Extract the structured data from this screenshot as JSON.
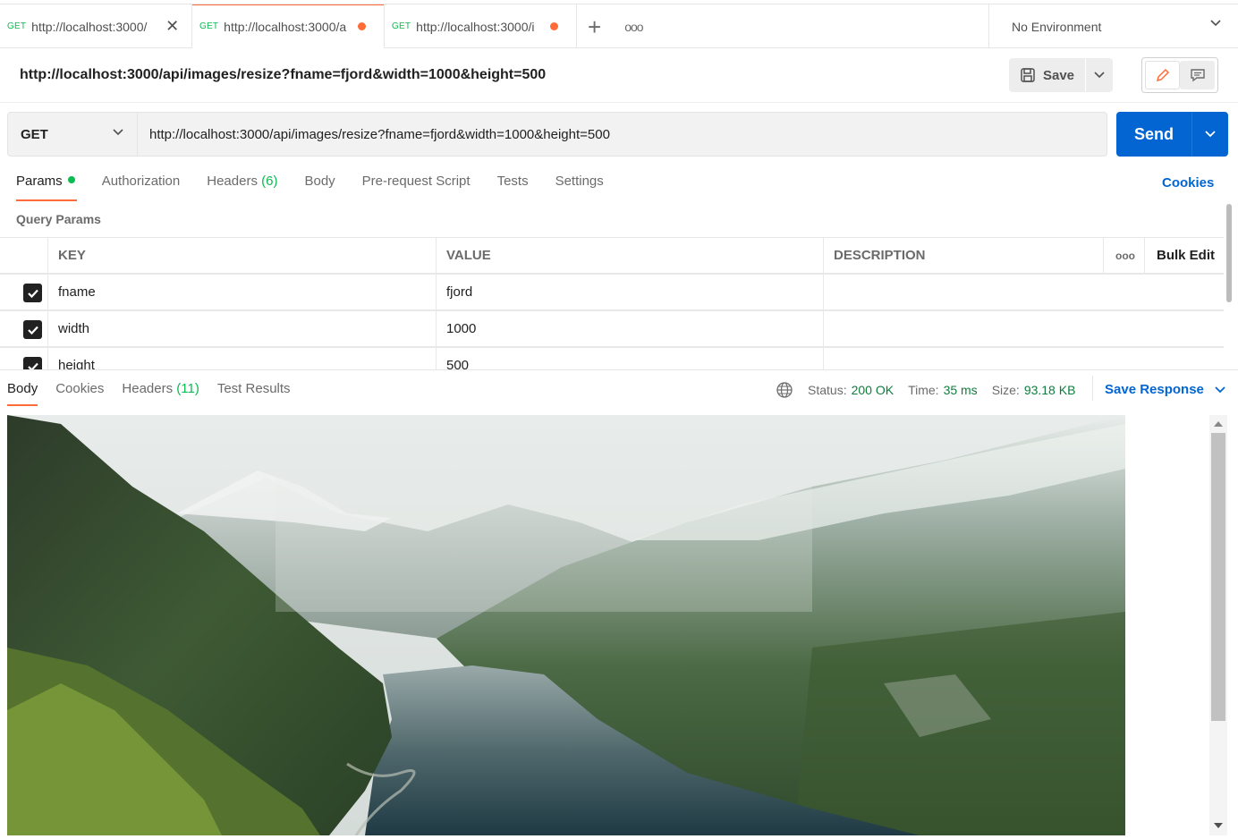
{
  "tabs": [
    {
      "method": "GET",
      "url": "http://localhost:3000/",
      "state": "close"
    },
    {
      "method": "GET",
      "url": "http://localhost:3000/a",
      "state": "unsaved"
    },
    {
      "method": "GET",
      "url": "http://localhost:3000/i",
      "state": "unsaved"
    }
  ],
  "environment": "No Environment",
  "request": {
    "title": "http://localhost:3000/api/images/resize?fname=fjord&width=1000&height=500",
    "save_label": "Save",
    "method": "GET",
    "url": "http://localhost:3000/api/images/resize?fname=fjord&width=1000&height=500",
    "send_label": "Send"
  },
  "request_tabs": {
    "params": "Params",
    "authorization": "Authorization",
    "headers": "Headers",
    "headers_count": "(6)",
    "body": "Body",
    "prerequest": "Pre-request Script",
    "tests": "Tests",
    "settings": "Settings",
    "cookies": "Cookies"
  },
  "query_params": {
    "title": "Query Params",
    "columns": {
      "key": "KEY",
      "value": "VALUE",
      "description": "DESCRIPTION",
      "more": "ooo",
      "bulk_edit": "Bulk Edit"
    },
    "rows": [
      {
        "key": "fname",
        "value": "fjord",
        "description": ""
      },
      {
        "key": "width",
        "value": "1000",
        "description": ""
      },
      {
        "key": "height",
        "value": "500",
        "description": ""
      }
    ]
  },
  "response": {
    "tabs": {
      "body": "Body",
      "cookies": "Cookies",
      "headers": "Headers",
      "headers_count": "(11)",
      "test_results": "Test Results"
    },
    "status_label": "Status:",
    "status_value": "200 OK",
    "time_label": "Time:",
    "time_value": "35 ms",
    "size_label": "Size:",
    "size_value": "93.18 KB",
    "save_response": "Save Response"
  },
  "colors": {
    "accent": "#ff6c37",
    "primary": "#0265d2",
    "success": "#0cbb52"
  }
}
